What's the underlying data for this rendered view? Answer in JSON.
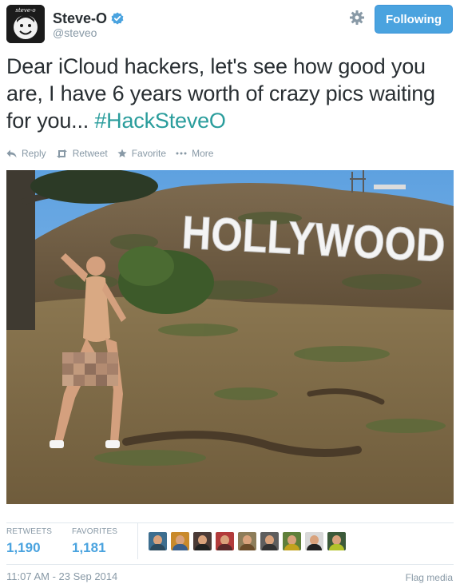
{
  "author": {
    "display_name": "Steve-O",
    "handle": "@steveo",
    "avatar_text": "steve-o",
    "verified": true
  },
  "header": {
    "follow_button_label": "Following"
  },
  "tweet": {
    "text_before": "Dear iCloud hackers, let's see how good you are, I have 6 years worth of crazy pics waiting for you... ",
    "hashtag": "#HackSteveO"
  },
  "actions": {
    "reply": "Reply",
    "retweet": "Retweet",
    "favorite": "Favorite",
    "more": "More"
  },
  "photo": {
    "sign_text": "HOLLYWOOD"
  },
  "stats": {
    "retweets_label": "RETWEETS",
    "retweets_value": "1,190",
    "favorites_label": "FAVORITES",
    "favorites_value": "1,181"
  },
  "favoriters": [
    {
      "name": "favoriter-1",
      "bg": "#3d6e8f",
      "shirt": "#2c4a5e"
    },
    {
      "name": "favoriter-2",
      "bg": "#c98a2b",
      "shirt": "#3b5f8a"
    },
    {
      "name": "favoriter-3",
      "bg": "#4a3a36",
      "shirt": "#222222"
    },
    {
      "name": "favoriter-4",
      "bg": "#b23b3b",
      "shirt": "#5a2a2a"
    },
    {
      "name": "favoriter-5",
      "bg": "#8d7d5a",
      "shirt": "#6b4c2a"
    },
    {
      "name": "favoriter-6",
      "bg": "#5e5e5e",
      "shirt": "#333333"
    },
    {
      "name": "favoriter-7",
      "bg": "#5f7f3a",
      "shirt": "#c2a21e"
    },
    {
      "name": "favoriter-8",
      "bg": "#d8d8d8",
      "shirt": "#222222"
    },
    {
      "name": "favoriter-9",
      "bg": "#3c5a3a",
      "shirt": "#b3c22a"
    }
  ],
  "footer": {
    "timestamp": "11:07 AM - 23 Sep 2014",
    "flag_media": "Flag media"
  },
  "colors": {
    "brand_blue": "#4aa3df",
    "hashtag": "#2a9d9c",
    "muted": "#8899a6",
    "text": "#292f33"
  }
}
